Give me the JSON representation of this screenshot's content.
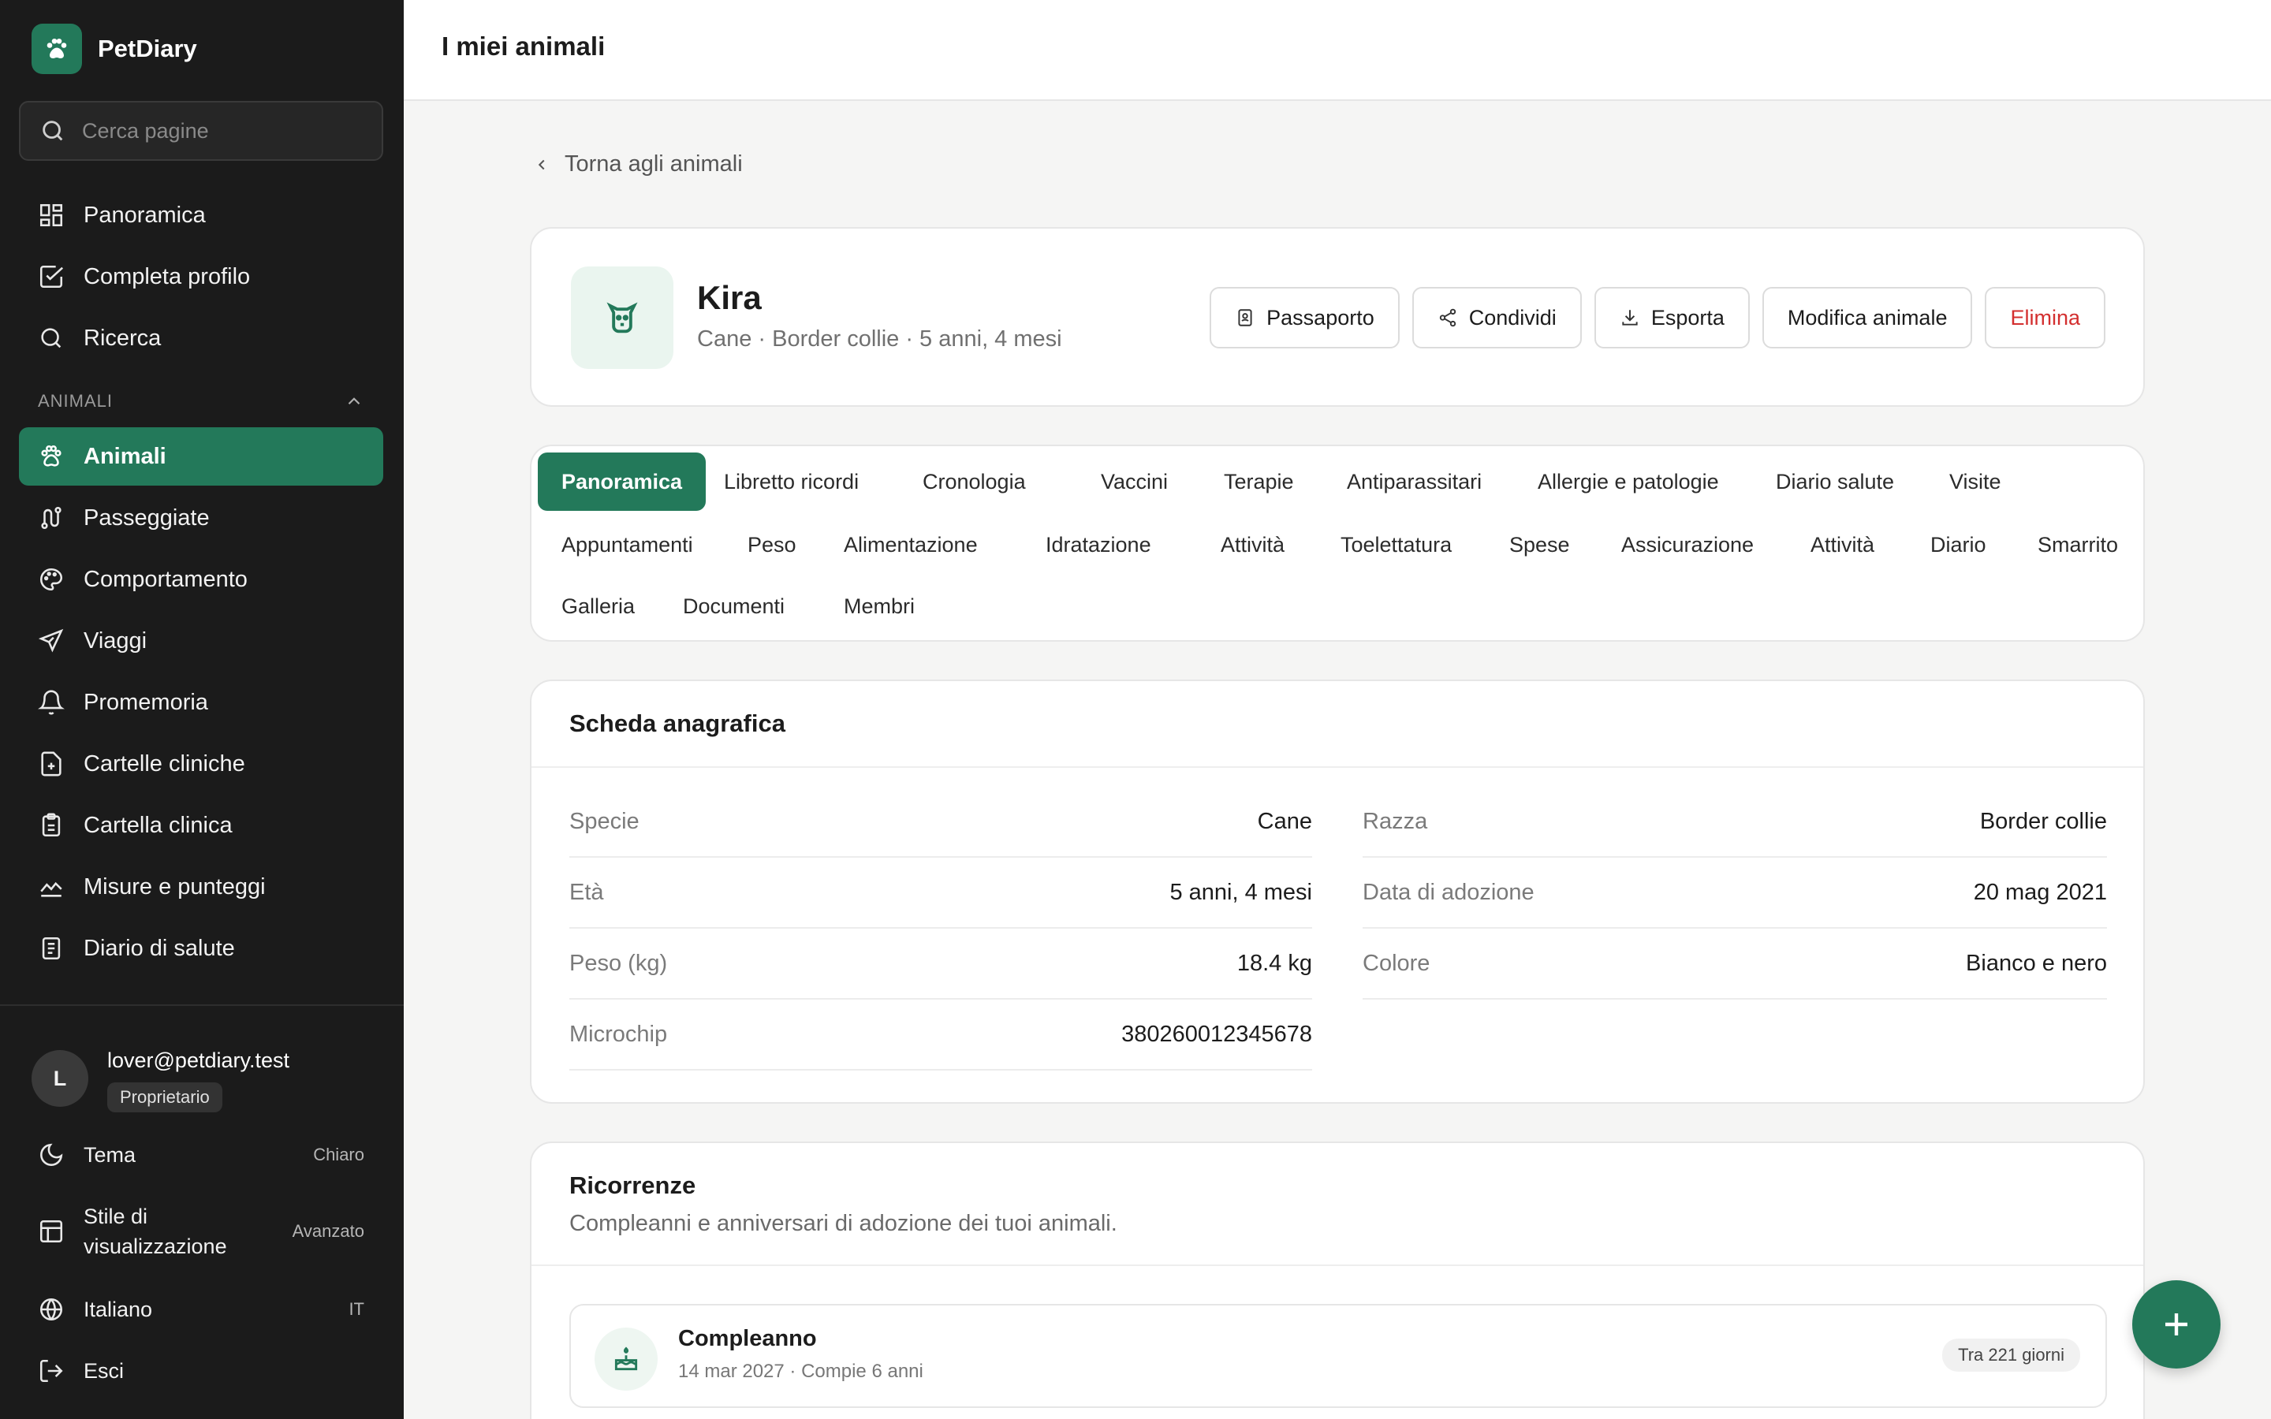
{
  "app": {
    "name": "PetDiary"
  },
  "sidebar": {
    "search_placeholder": "Cerca pagine",
    "top_items": [
      {
        "label": "Panoramica",
        "icon": "grid-icon"
      },
      {
        "label": "Completa profilo",
        "icon": "checkbox-icon"
      },
      {
        "label": "Ricerca",
        "icon": "search-icon"
      }
    ],
    "section_label": "ANIMALI",
    "items": [
      {
        "label": "Animali",
        "icon": "paw-icon",
        "active": true
      },
      {
        "label": "Passeggiate",
        "icon": "route-icon"
      },
      {
        "label": "Comportamento",
        "icon": "palette-icon"
      },
      {
        "label": "Viaggi",
        "icon": "plane-icon"
      },
      {
        "label": "Promemoria",
        "icon": "bell-icon"
      },
      {
        "label": "Cartelle cliniche",
        "icon": "file-plus-icon"
      },
      {
        "label": "Cartella clinica",
        "icon": "clipboard-icon"
      },
      {
        "label": "Misure e punteggi",
        "icon": "chart-line-icon"
      },
      {
        "label": "Diario di salute",
        "icon": "notebook-icon"
      }
    ],
    "user": {
      "initial": "L",
      "email": "lover@petdiary.test",
      "role": "Proprietario"
    },
    "settings": {
      "theme_label": "Tema",
      "theme_value": "Chiaro",
      "view_label": "Stile di visualizzazione",
      "view_value": "Avanzato",
      "lang_label": "Italiano",
      "lang_value": "IT",
      "logout_label": "Esci"
    }
  },
  "header": {
    "title": "I miei animali"
  },
  "back_link": "Torna agli animali",
  "pet": {
    "name": "Kira",
    "subtitle": "Cane · Border collie · 5 anni, 4 mesi",
    "actions": {
      "passport": "Passaporto",
      "share": "Condividi",
      "export": "Esporta",
      "edit": "Modifica animale",
      "delete": "Elimina"
    }
  },
  "tabs": [
    "Panoramica",
    "Libretto ricordi",
    "Cronologia",
    "Vaccini",
    "Terapie",
    "Antiparassitari",
    "Allergie e patologie",
    "Diario salute",
    "Visite",
    "Appuntamenti",
    "Peso",
    "Alimentazione",
    "Idratazione",
    "Attività",
    "Toelettatura",
    "Spese",
    "Assicurazione",
    "Attività",
    "Diario",
    "Smarrito",
    "Galleria",
    "Documenti",
    "Membri"
  ],
  "profile": {
    "title": "Scheda anagrafica",
    "fields": [
      {
        "label": "Specie",
        "value": "Cane"
      },
      {
        "label": "Razza",
        "value": "Border collie"
      },
      {
        "label": "Età",
        "value": "5 anni, 4 mesi"
      },
      {
        "label": "Data di adozione",
        "value": "20 mag 2021"
      },
      {
        "label": "Peso (kg)",
        "value": "18.4 kg"
      },
      {
        "label": "Colore",
        "value": "Bianco e nero"
      },
      {
        "label": "Microchip",
        "value": "380260012345678"
      }
    ]
  },
  "recurrences": {
    "title": "Ricorrenze",
    "subtitle": "Compleanni e anniversari di adozione dei tuoi animali.",
    "item": {
      "title": "Compleanno",
      "meta": "14 mar 2027 · Compie 6 anni",
      "badge": "Tra 221 giorni"
    }
  },
  "colors": {
    "accent": "#23795a",
    "sidebar": "#1b1b1b",
    "danger": "#d32f2f"
  }
}
